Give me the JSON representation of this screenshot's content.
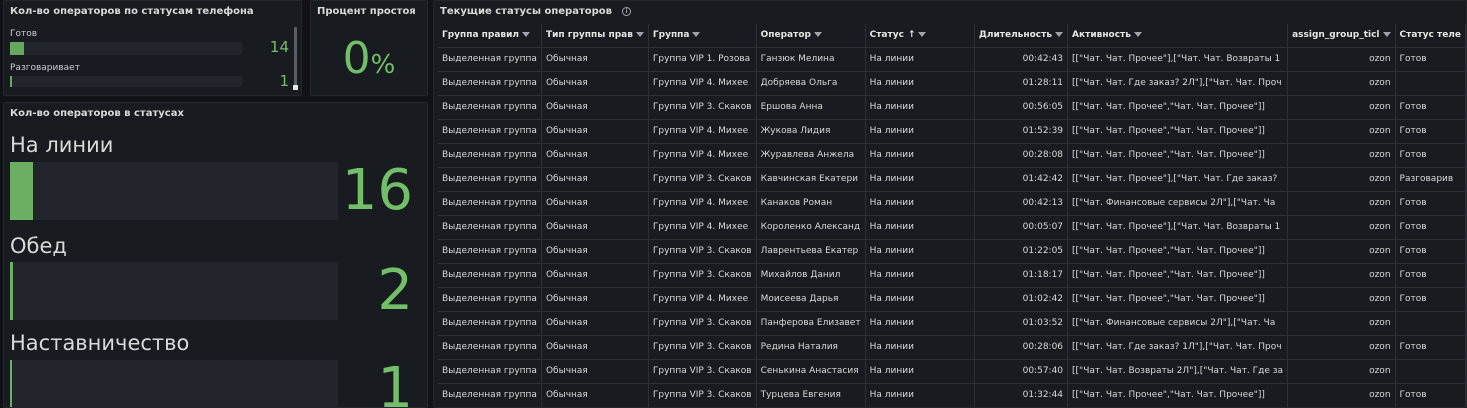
{
  "phone_panel": {
    "title": "Кол-во операторов по статусам телефона",
    "rows": [
      {
        "label": "Готов",
        "value": "14",
        "fraction": 0.06
      },
      {
        "label": "Разговаривает",
        "value": "1",
        "fraction": 0.0
      }
    ],
    "accent": "#73bf69"
  },
  "idle_panel": {
    "title": "Процент простоя",
    "value": "0",
    "unit": "%"
  },
  "status_panel": {
    "title": "Кол-во операторов в статусах",
    "rows": [
      {
        "label": "На линии",
        "value": "16",
        "fraction": 0.07
      },
      {
        "label": "Обед",
        "value": "2",
        "fraction": 0.01
      },
      {
        "label": "Наставничество",
        "value": "1",
        "fraction": 0.005
      }
    ]
  },
  "table_panel": {
    "title": "Текущие статусы операторов",
    "info_icon": "info-icon",
    "columns": [
      "Группа правил",
      "Тип группы прав",
      "Группа",
      "Оператор",
      "Статус",
      "Длительность",
      "Активность",
      "assign_group_ticl",
      "Статус теле"
    ],
    "sort_column": "Статус",
    "sort_glyph": "↑",
    "rows": [
      [
        "Выделенная группа",
        "Обычная",
        "Группа VIP 1. Розова",
        "Ганзюк Мелина",
        "На линии",
        "00:42:43",
        "[[\"Чат. Чат. Прочее\"],[\"Чат. Чат. Возвраты 1",
        "ozon",
        "Готов"
      ],
      [
        "Выделенная группа",
        "Обычная",
        "Группа VIP 4. Михее",
        "Добряева Ольга",
        "На линии",
        "01:28:11",
        "[[\"Чат. Чат. Где заказ? 2Л\"],[\"Чат. Чат. Проч",
        "ozon",
        ""
      ],
      [
        "Выделенная группа",
        "Обычная",
        "Группа VIP 3. Скаков",
        "Ершова Анна",
        "На линии",
        "00:56:05",
        "[[\"Чат. Чат. Прочее\",\"Чат. Чат. Прочее\"]]",
        "ozon",
        "Готов"
      ],
      [
        "Выделенная группа",
        "Обычная",
        "Группа VIP 4. Михее",
        "Жукова Лидия",
        "На линии",
        "01:52:39",
        "[[\"Чат. Чат. Прочее\",\"Чат. Чат. Прочее\"]]",
        "ozon",
        "Готов"
      ],
      [
        "Выделенная группа",
        "Обычная",
        "Группа VIP 4. Михее",
        "Журавлева Анжела",
        "На линии",
        "00:28:08",
        "[[\"Чат. Чат. Прочее\",\"Чат. Чат. Прочее\"]]",
        "ozon",
        "Готов"
      ],
      [
        "Выделенная группа",
        "Обычная",
        "Группа VIP 3. Скаков",
        "Кавчинская Екатери",
        "На линии",
        "01:42:42",
        "[[\"Чат. Чат. Прочее\"],[\"Чат. Чат. Где заказ?",
        "ozon",
        "Разговарив"
      ],
      [
        "Выделенная группа",
        "Обычная",
        "Группа VIP 4. Михее",
        "Канаков Роман",
        "На линии",
        "00:42:13",
        "[[\"Чат. Финансовые сервисы 2Л\"],[\"Чат. Ча",
        "ozon",
        "Готов"
      ],
      [
        "Выделенная группа",
        "Обычная",
        "Группа VIP 4. Михее",
        "Короленко Александ",
        "На линии",
        "00:05:07",
        "[[\"Чат. Чат. Прочее\"],[\"Чат. Чат. Возвраты 1",
        "ozon",
        "Готов"
      ],
      [
        "Выделенная группа",
        "Обычная",
        "Группа VIP 3. Скаков",
        "Лаврентьева Екатер",
        "На линии",
        "01:22:05",
        "[[\"Чат. Чат. Прочее\",\"Чат. Чат. Прочее\"]]",
        "ozon",
        "Готов"
      ],
      [
        "Выделенная группа",
        "Обычная",
        "Группа VIP 3. Скаков",
        "Михайлов Данил",
        "На линии",
        "01:18:17",
        "[[\"Чат. Чат. Прочее\",\"Чат. Чат. Прочее\"]]",
        "ozon",
        "Готов"
      ],
      [
        "Выделенная группа",
        "Обычная",
        "Группа VIP 4. Михее",
        "Моисеева Дарья",
        "На линии",
        "01:02:42",
        "[[\"Чат. Чат. Прочее\",\"Чат. Чат. Прочее\"]]",
        "ozon",
        "Готов"
      ],
      [
        "Выделенная группа",
        "Обычная",
        "Группа VIP 3. Скаков",
        "Панферова Елизавет",
        "На линии",
        "01:03:52",
        "[[\"Чат. Финансовые сервисы 2Л\"],[\"Чат. Ча",
        "ozon",
        ""
      ],
      [
        "Выделенная группа",
        "Обычная",
        "Группа VIP 3. Скаков",
        "Редина Наталия",
        "На линии",
        "00:28:06",
        "[[\"Чат. Чат. Где заказ? 1Л\"],[\"Чат. Чат. Проч",
        "ozon",
        "Готов"
      ],
      [
        "Выделенная группа",
        "Обычная",
        "Группа VIP 3. Скаков",
        "Сенькина Анастасия",
        "На линии",
        "00:57:40",
        "[[\"Чат. Чат. Возвраты 2Л\"],[\"Чат. Чат. Где за",
        "ozon",
        ""
      ],
      [
        "Выделенная группа",
        "Обычная",
        "Группа VIP 3. Скаков",
        "Турцева Евгения",
        "На линии",
        "01:32:44",
        "[[\"Чат. Чат. Прочее\",\"Чат. Чат. Прочее\"]]",
        "ozon",
        "Готов"
      ]
    ]
  }
}
